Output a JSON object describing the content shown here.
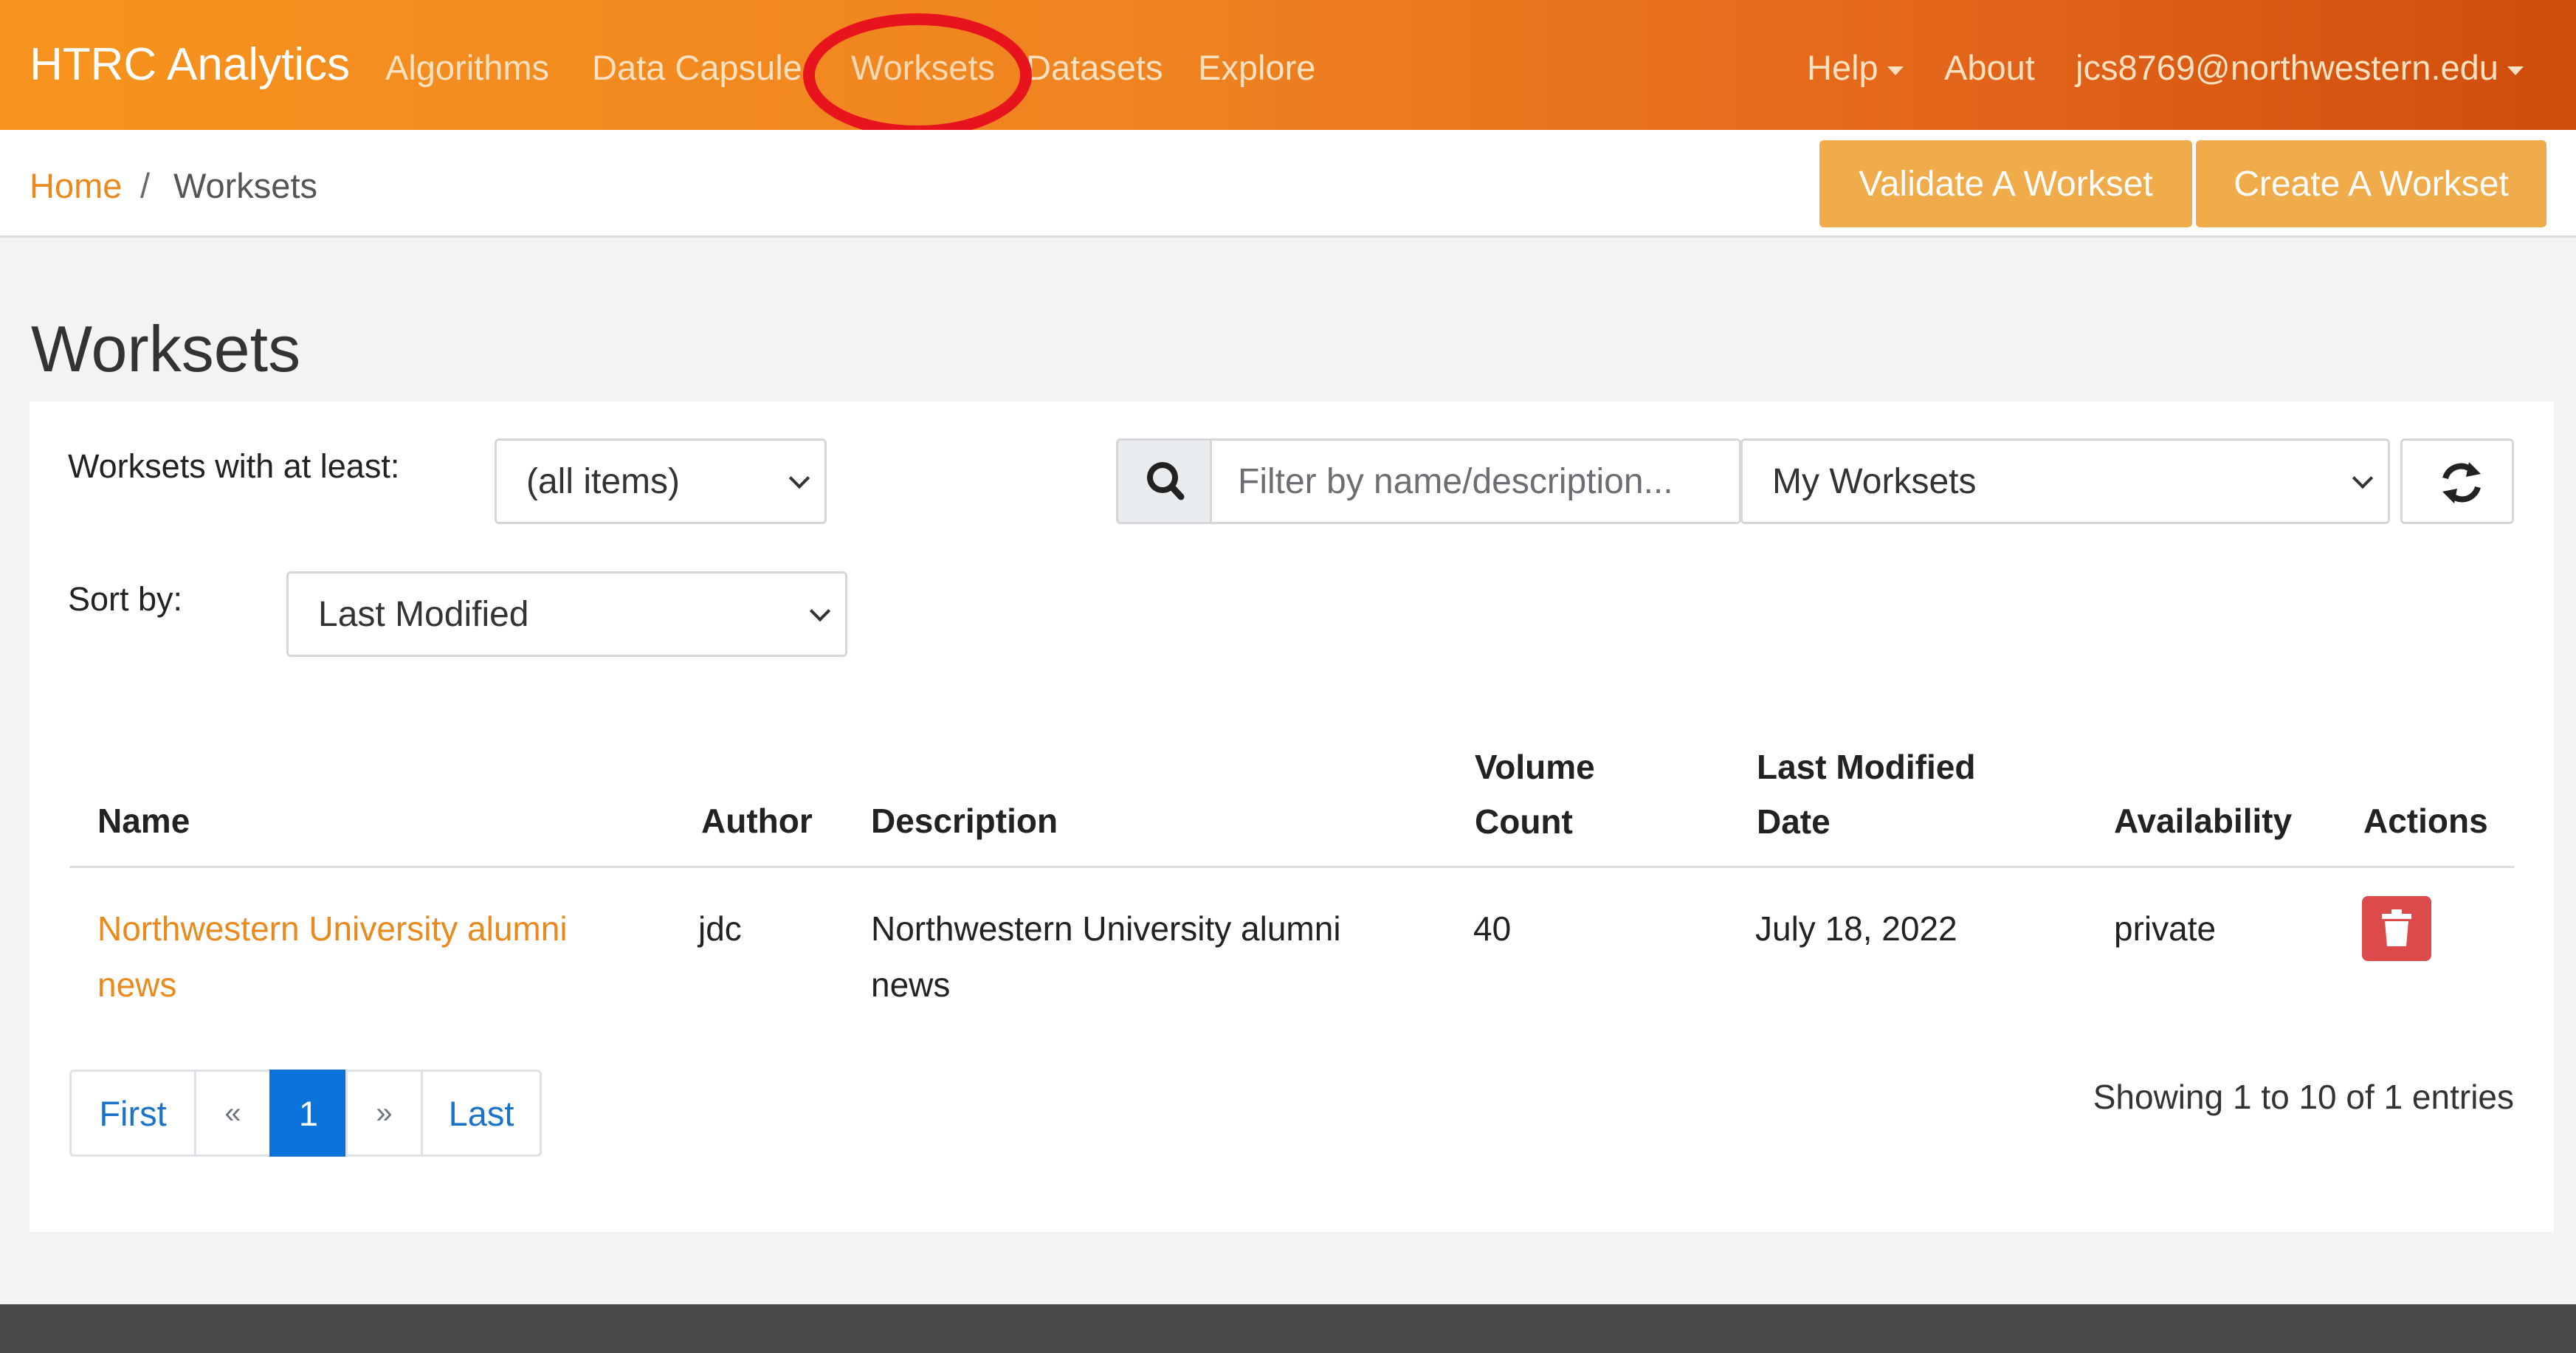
{
  "nav": {
    "brand": "HTRC Analytics",
    "links": [
      "Algorithms",
      "Data Capsule",
      "Worksets",
      "Datasets",
      "Explore"
    ],
    "help": "Help",
    "about": "About",
    "user": "jcs8769@northwestern.edu"
  },
  "breadcrumb": {
    "home": "Home",
    "separator": "/",
    "current": "Worksets"
  },
  "actions": {
    "validate": "Validate A Workset",
    "create": "Create A Workset"
  },
  "page": {
    "title": "Worksets"
  },
  "filters": {
    "min_label": "Worksets with at least:",
    "min_value": "(all items)",
    "sort_label": "Sort by:",
    "sort_value": "Last Modified",
    "search_placeholder": "Filter by name/description...",
    "scope_value": "My Worksets"
  },
  "table": {
    "headers": {
      "name": "Name",
      "author": "Author",
      "description": "Description",
      "volume_1": "Volume",
      "volume_2": "Count",
      "modified_1": "Last Modified",
      "modified_2": "Date",
      "availability": "Availability",
      "actions": "Actions"
    },
    "rows": [
      {
        "name_1": "Northwestern University alumni",
        "name_2": "news",
        "author": "jdc",
        "description_1": "Northwestern University alumni",
        "description_2": "news",
        "volume_count": "40",
        "last_modified": "July 18, 2022",
        "availability": "private"
      }
    ]
  },
  "pagination": {
    "first": "First",
    "prev": "«",
    "current": "1",
    "next": "»",
    "last": "Last"
  },
  "summary": "Showing 1  to 10  of 1  entries",
  "colors": {
    "navbar_start": "#f7931e",
    "navbar_end": "#cf4d0c",
    "accent_button": "#f0ab4b",
    "link": "#e98a1e",
    "active_page": "#0b73d9",
    "danger": "#dc4a4a",
    "highlight_ring": "#e8141d"
  },
  "icons": [
    "search-icon",
    "refresh-icon",
    "trash-icon",
    "caret-down-icon",
    "chevron-down-icon"
  ]
}
